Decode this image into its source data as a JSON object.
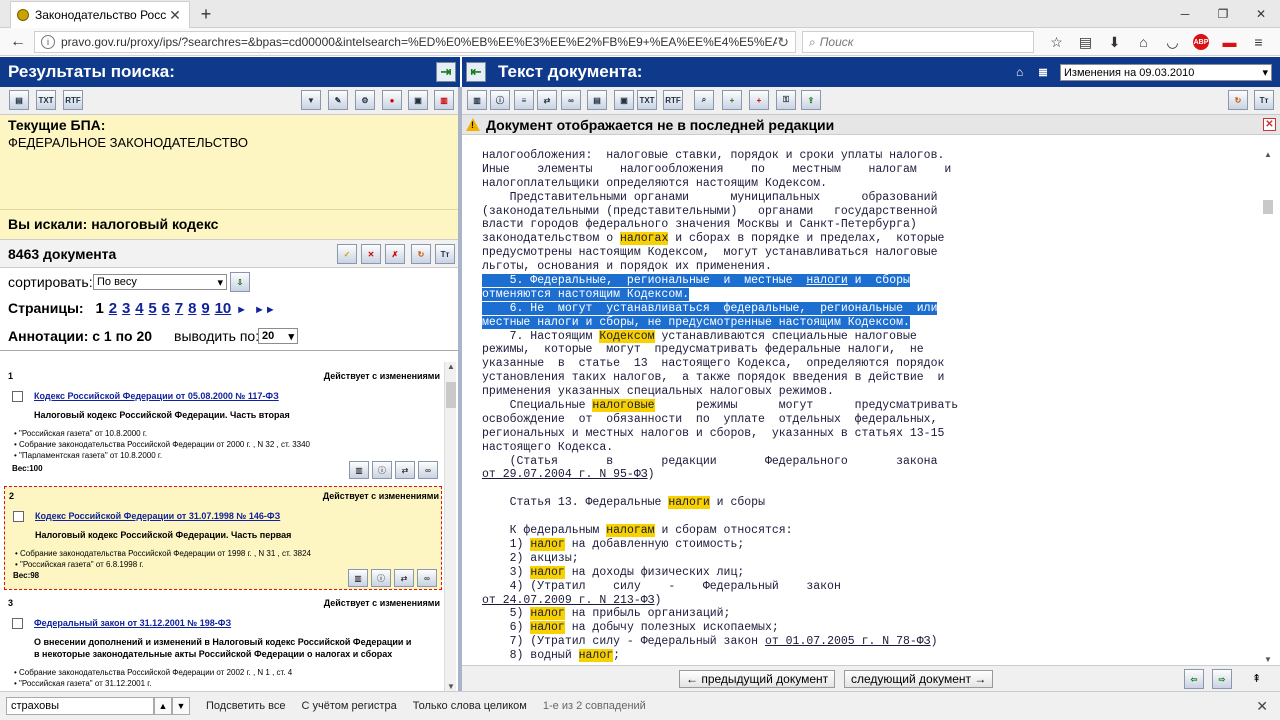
{
  "browser": {
    "tab_title": "Законодательство Росси...",
    "url": "pravo.gov.ru/proxy/ips/?searchres=&bpas=cd00000&intelsearch=%ED%E0%EB%EE%E3%EE%E2%FB%E9+%EA%EE%E4%E5%EA%F1&so",
    "search_placeholder": "Поиск",
    "abp_label": "ABP"
  },
  "left": {
    "header": "Результаты поиска:",
    "current_bpa_label": "Текущие БПА:",
    "current_bpa_value": "ФЕДЕРАЛЬНОЕ ЗАКОНОДАТЕЛЬСТВО",
    "searched_label": "Вы искали: налоговый кодекс",
    "count_label": "8463 документа",
    "sort_label": "сортировать:",
    "sort_value": "По весу",
    "pages_label": "Страницы:",
    "pages": [
      "1",
      "2",
      "3",
      "4",
      "5",
      "6",
      "7",
      "8",
      "9",
      "10"
    ],
    "annotations_label": "Аннотации: с 1 по 20",
    "show_label": "выводить по:",
    "show_value": "20",
    "results": [
      {
        "num": "1",
        "status": "Действует с изменениями",
        "title": "Кодекс Российской Федерации от 05.08.2000 № 117-ФЗ",
        "subtitle": "Налоговый кодекс Российской Федерации. Часть вторая",
        "sources": [
          "\"Российская газета\" от 10.8.2000 г.",
          "Собрание законодательства Российской Федерации от 2000 г. , N 32 , ст. 3340",
          "\"Парламентская газета\" от 10.8.2000 г."
        ],
        "weight": "Вес:100"
      },
      {
        "num": "2",
        "status": "Действует с изменениями",
        "title": "Кодекс Российской Федерации от 31.07.1998 № 146-ФЗ",
        "subtitle": "Налоговый кодекс Российской Федерации. Часть первая",
        "sources": [
          "Собрание законодательства Российской Федерации от 1998 г. , N 31 , ст. 3824",
          "\"Российская газета\" от 6.8.1998 г."
        ],
        "weight": "Вес:98"
      },
      {
        "num": "3",
        "status": "Действует с изменениями",
        "title": "Федеральный закон от 31.12.2001 № 198-ФЗ",
        "subtitle": "О внесении дополнений и изменений в Налоговый кодекс Российской Федерации и в некоторые законодательные акты Российской Федерации о налогах и сборах",
        "sources": [
          "Собрание законодательства Российской Федерации от 2002 г. , N 1 , ст. 4",
          "\"Российская газета\" от 31.12.2001 г."
        ],
        "weight": ""
      }
    ]
  },
  "right": {
    "header": "Текст документа:",
    "edition_value": "Изменения на 09.03.2010",
    "warning": "Документ отображается не в последней редакции",
    "prev_doc": "← предыдущий документ",
    "next_doc": "следующий документ →"
  },
  "findbar": {
    "value": "страховы",
    "highlight_all": "Подсветить все",
    "match_case": "С учётом регистра",
    "whole_words": "Только слова целиком",
    "status": "1-е из 2 совпадений"
  },
  "icons": {
    "txt": "TXT",
    "rtf": "RTF",
    "tt": "Tт"
  }
}
